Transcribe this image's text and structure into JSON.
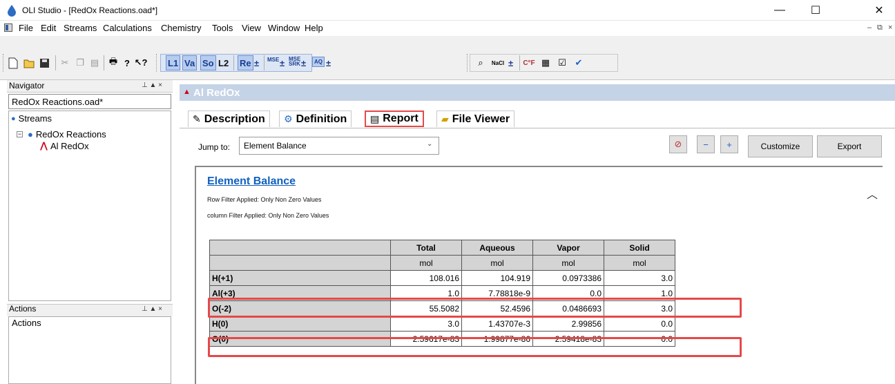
{
  "window": {
    "title": "OLI Studio - [RedOx Reactions.oad*]",
    "controls": {
      "minimize": "—",
      "maximize": "☐",
      "close": "✕"
    }
  },
  "menu": {
    "items": [
      "File",
      "Edit",
      "Streams",
      "Calculations",
      "Chemistry",
      "Tools",
      "View",
      "Window",
      "Help"
    ],
    "mdi": {
      "minimize": "–",
      "restore": "⧉",
      "close": "×"
    }
  },
  "toolbar": {
    "icons": [
      "new-icon",
      "open-icon",
      "save-icon",
      "cut-icon",
      "copy-icon",
      "paste-icon",
      "print-icon",
      "help-icon",
      "context-help-icon"
    ],
    "modes": {
      "l1": "L1",
      "va": "Va",
      "so": "So",
      "l2": "L2",
      "re": "Re"
    },
    "small": {
      "mse": "MSE",
      "mse_srk": "MSE SRK",
      "aq": "AQ"
    },
    "right_icons": [
      "binoculars-icon",
      "nacl-icon",
      "cf-icon",
      "chart-icon",
      "properties-icon",
      "check-icon"
    ],
    "dropdown_glyph": "±"
  },
  "navigator": {
    "title": "Navigator",
    "pane_controls": "⊥ ▲ ×",
    "file": "RedOx Reactions.oad*",
    "tree": {
      "streams": "Streams",
      "redox_reactions": "RedOx Reactions",
      "al_redox": "Al RedOx"
    }
  },
  "actions": {
    "title": "Actions",
    "pane_controls": "⊥ ▲ ×",
    "body_label": "Actions"
  },
  "document": {
    "title": "Al RedOx",
    "tabs": [
      "Description",
      "Definition",
      "Report",
      "File Viewer"
    ],
    "active_tab": "Report",
    "jump_to_label": "Jump to:",
    "jump_to_value": "Element Balance",
    "buttons": {
      "customize": "Customize",
      "export": "Export"
    }
  },
  "report": {
    "section_title": "Element Balance",
    "row_filter": "Row Filter Applied: Only Non Zero Values",
    "column_filter": "column Filter Applied: Only Non Zero Values",
    "columns": [
      "Total",
      "Aqueous",
      "Vapor",
      "Solid"
    ],
    "units": [
      "mol",
      "mol",
      "mol",
      "mol"
    ],
    "rows": [
      {
        "label": "H(+1)",
        "values": [
          "108.016",
          "104.919",
          "0.0973386",
          "3.0"
        ]
      },
      {
        "label": "Al(+3)",
        "values": [
          "1.0",
          "7.78818e-9",
          "0.0",
          "1.0"
        ]
      },
      {
        "label": "O(-2)",
        "values": [
          "55.5082",
          "52.4596",
          "0.0486693",
          "3.0"
        ]
      },
      {
        "label": "H(0)",
        "values": [
          "3.0",
          "1.43707e-3",
          "2.99856",
          "0.0"
        ]
      },
      {
        "label": "O(0)",
        "values": [
          "2.59617e-83",
          "1.99877e-86",
          "2.59418e-83",
          "0.0"
        ]
      }
    ]
  },
  "colors": {
    "highlight": "#e64848",
    "header_blue": "#c5d3e7",
    "link": "#1060c0"
  }
}
